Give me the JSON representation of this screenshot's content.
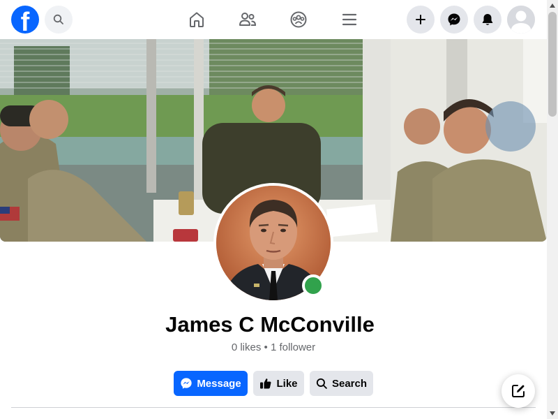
{
  "topbar": {
    "logo_letter": "f",
    "nav_icons": [
      "home-icon",
      "friends-icon",
      "groups-icon",
      "menu-icon"
    ],
    "action_icons": [
      "plus-icon",
      "messenger-icon",
      "bell-icon",
      "account-avatar"
    ]
  },
  "profile": {
    "name": "James C McConville",
    "stats": "0 likes • 1 follower",
    "online": true
  },
  "actions": {
    "message_label": "Message",
    "like_label": "Like",
    "search_label": "Search"
  },
  "colors": {
    "brand_blue": "#0866ff",
    "online_green": "#31a24c",
    "secondary_button": "#e4e6eb",
    "muted_text": "#65676b"
  }
}
